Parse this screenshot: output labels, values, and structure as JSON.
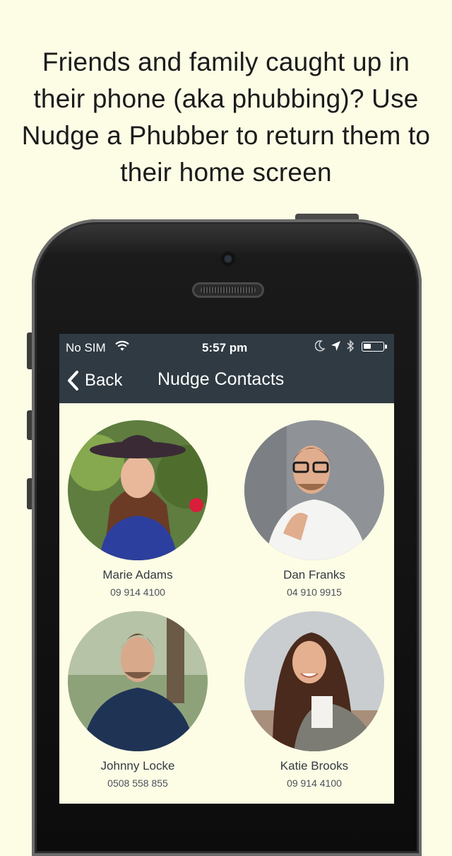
{
  "headline": "Friends and family caught up in their phone (aka phubbing)? Use Nudge a Phubber to return them to their home screen",
  "status_bar": {
    "carrier": "No SIM",
    "time": "5:57 pm",
    "icons": [
      "wifi-icon",
      "moon-icon",
      "location-arrow-icon",
      "bluetooth-icon",
      "battery-icon"
    ],
    "battery_level": 0.4
  },
  "nav": {
    "back_label": "Back",
    "title": "Nudge Contacts",
    "bar_color": "#2f3a42"
  },
  "contacts": [
    {
      "name": "Marie Adams",
      "phone": "09 914 4100"
    },
    {
      "name": "Dan Franks",
      "phone": "04 910 9915"
    },
    {
      "name": "Johnny Locke",
      "phone": "0508 558 855"
    },
    {
      "name": "Katie Brooks",
      "phone": "09 914 4100"
    }
  ],
  "colors": {
    "background": "#fdfde6",
    "text": "#333a40"
  }
}
